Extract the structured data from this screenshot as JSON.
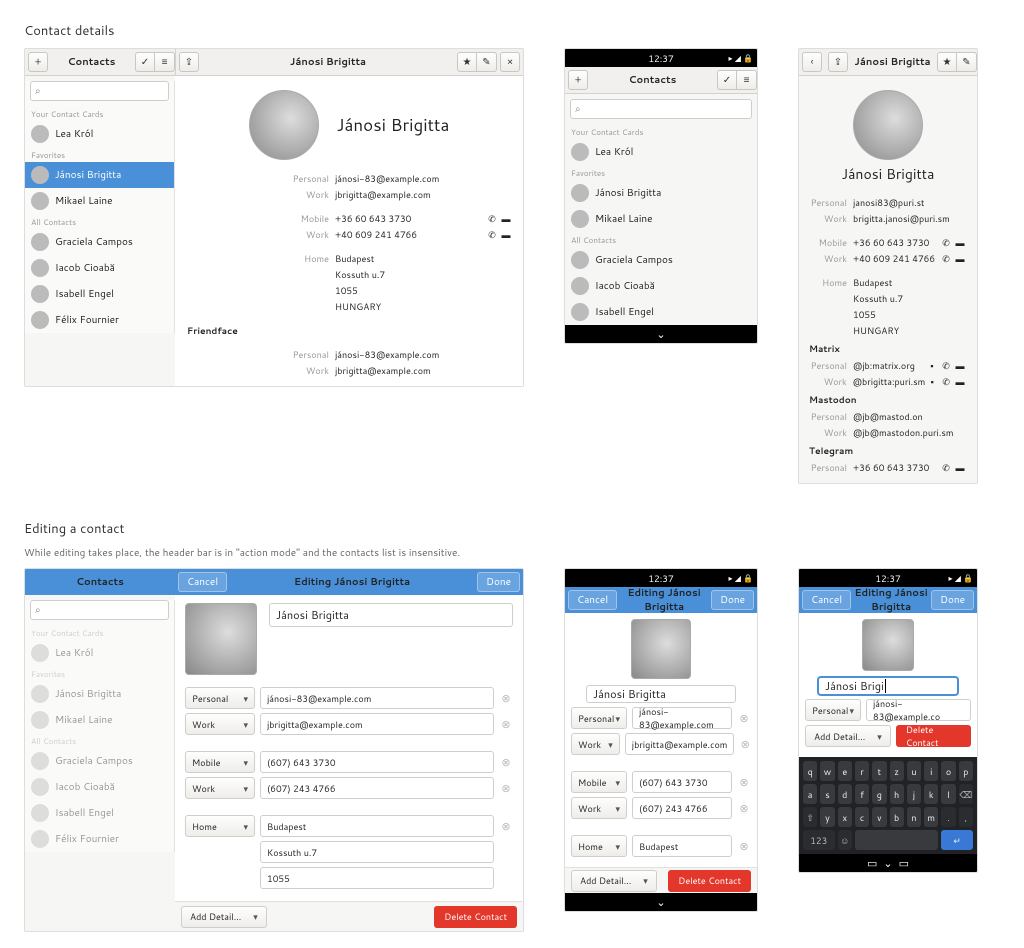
{
  "section1_title": "Contact details",
  "section2_title": "Editing a contact",
  "section2_sub": "While editing takes place, the header bar is in \"action mode\" and the contacts list is insensitive.",
  "time": "12:37",
  "app_title": "Contacts",
  "sidebar": {
    "your_cards": "Your Contact Cards",
    "favorites": "Favorites",
    "all": "All Contacts",
    "items": [
      {
        "label": "Lea Król"
      },
      {
        "label": "Jánosi Brigitta"
      },
      {
        "label": "Mikael Laine"
      },
      {
        "label": "Graciela Campos"
      },
      {
        "label": "Iacob Cioabă"
      },
      {
        "label": "Isabell Engel"
      },
      {
        "label": "Félix Fournier"
      }
    ]
  },
  "contact": {
    "name": "Jánosi Brigitta",
    "emails": [
      {
        "type": "Personal",
        "value": "jánosi-83@example.com"
      },
      {
        "type": "Work",
        "value": "jbrigitta@example.com"
      }
    ],
    "phones": [
      {
        "type": "Mobile",
        "value": "+36 60 643 3730"
      },
      {
        "type": "Work",
        "value": "+40 609 241 4766"
      }
    ],
    "address": {
      "type": "Home",
      "lines": [
        "Budapest",
        "Kossuth u.7",
        "1055",
        "HUNGARY"
      ]
    },
    "provider": "Friendface",
    "prov_emails": [
      {
        "type": "Personal",
        "value": "jánosi-83@example.com"
      },
      {
        "type": "Work",
        "value": "jbrigitta@example.com"
      }
    ]
  },
  "contact_mobile": {
    "emails": [
      {
        "type": "Personal",
        "value": "janosi83@puri.st"
      },
      {
        "type": "Work",
        "value": "brigitta.janosi@puri.sm"
      }
    ],
    "phones": [
      {
        "type": "Mobile",
        "value": "+36 60 643 3730"
      },
      {
        "type": "Work",
        "value": "+40 609 241 4766"
      }
    ],
    "address": {
      "type": "Home",
      "lines": [
        "Budapest",
        "Kossuth u.7",
        "1055",
        "HUNGARY"
      ]
    },
    "matrix_hdr": "Matrix",
    "matrix": [
      {
        "type": "Personal",
        "value": "@jb:matrix.org"
      },
      {
        "type": "Work",
        "value": "@brigitta:puri.sm"
      }
    ],
    "mastodon_hdr": "Mastodon",
    "mastodon": [
      {
        "type": "Personal",
        "value": "@jb@mastod.on"
      },
      {
        "type": "Work",
        "value": "@jb@mastodon.puri.sm"
      }
    ],
    "telegram_hdr": "Telegram",
    "telegram": [
      {
        "type": "Personal",
        "value": "+36 60 643 3730"
      }
    ]
  },
  "edit": {
    "cancel": "Cancel",
    "done": "Done",
    "title": "Editing Jánosi Brigitta",
    "name": "Jánosi Brigitta",
    "emails": [
      {
        "type": "Personal",
        "value": "jánosi-83@example.com"
      },
      {
        "type": "Work",
        "value": "jbrigitta@example.com"
      }
    ],
    "phones": [
      {
        "type": "Mobile",
        "value": "(607) 643 3730"
      },
      {
        "type": "Work",
        "value": "(607) 243 4766"
      }
    ],
    "addr": {
      "type": "Home",
      "lines": [
        "Budapest",
        "Kossuth u.7",
        "1055"
      ]
    },
    "add": "Add Detail...",
    "delete": "Delete Contact"
  },
  "edit_partial": "Jánosi Brigi",
  "edit_mobile_email": "jánosi-83@example.co",
  "keys1": [
    "q",
    "w",
    "e",
    "r",
    "t",
    "z",
    "u",
    "i",
    "o",
    "p"
  ],
  "keys2": [
    "a",
    "s",
    "d",
    "f",
    "g",
    "h",
    "j",
    "k",
    "l"
  ],
  "keys3": [
    "y",
    "x",
    "c",
    "v",
    "b",
    "n",
    "m"
  ],
  "key_shift": "⇧",
  "key_bksp": "⌫",
  "key_123": "123",
  "key_ret": "↵"
}
